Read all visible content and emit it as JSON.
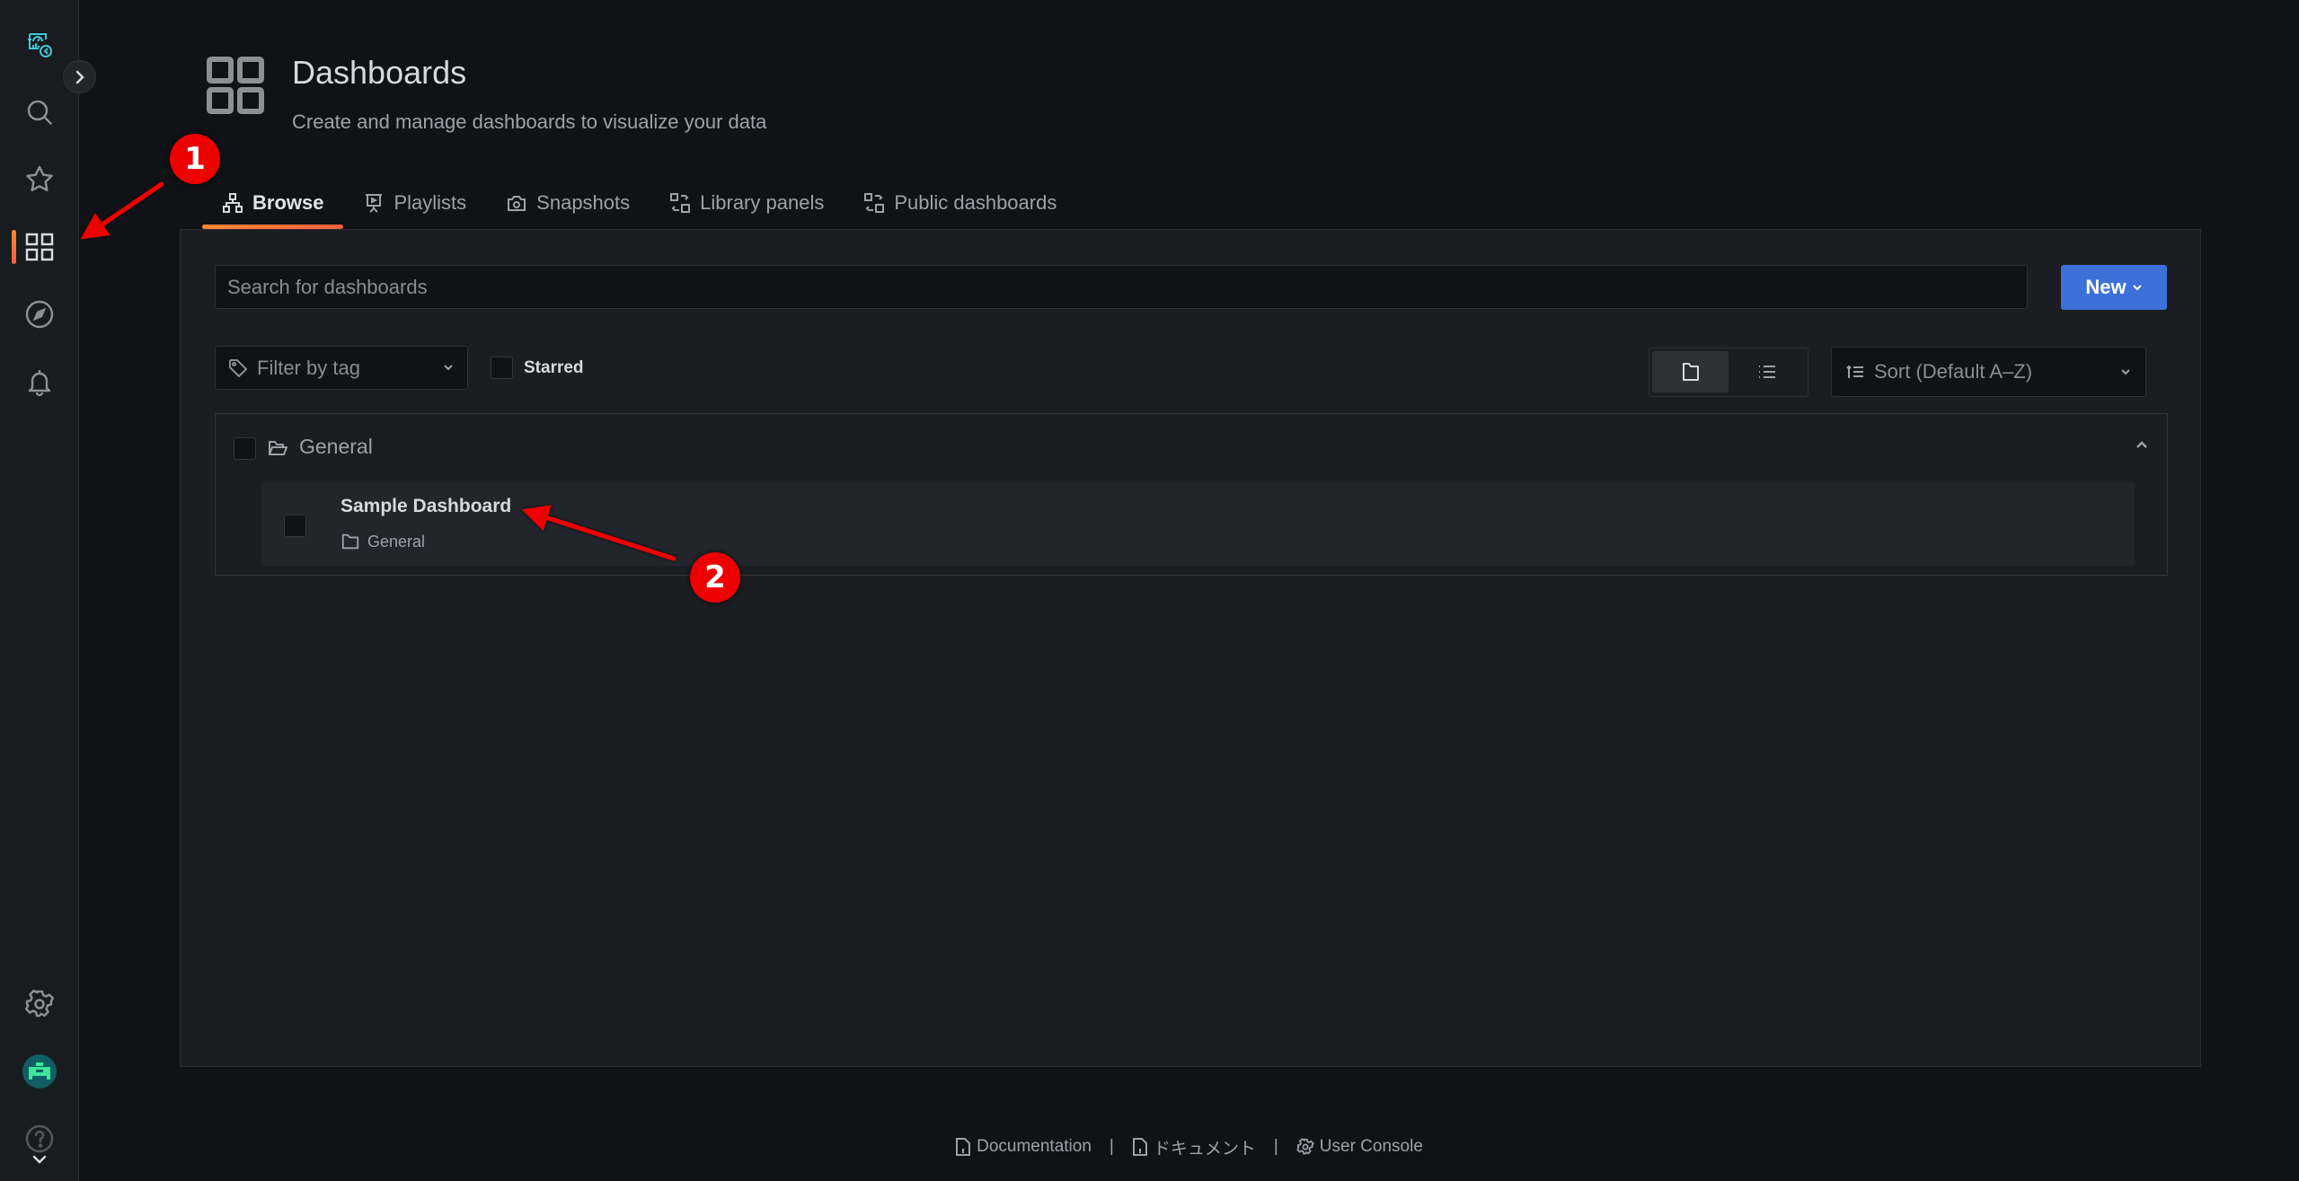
{
  "sidebar": {
    "items": [
      {
        "name": "home",
        "icon": "grafana-logo-icon",
        "active": false
      },
      {
        "name": "search",
        "icon": "search-icon",
        "active": false
      },
      {
        "name": "starred",
        "icon": "star-icon",
        "active": false
      },
      {
        "name": "dashboards",
        "icon": "dashboards-grid-icon",
        "active": true
      },
      {
        "name": "explore",
        "icon": "compass-icon",
        "active": false
      },
      {
        "name": "alerting",
        "icon": "bell-icon",
        "active": false
      }
    ],
    "bottom_items": [
      {
        "name": "administration",
        "icon": "gear-icon"
      },
      {
        "name": "profile",
        "icon": "avatar"
      },
      {
        "name": "help",
        "icon": "help-icon"
      }
    ],
    "accent_color": "#ff8833"
  },
  "header": {
    "title": "Dashboards",
    "subtitle": "Create and manage dashboards to visualize your data"
  },
  "tabs": [
    {
      "label": "Browse",
      "icon": "hierarchy-icon",
      "active": true
    },
    {
      "label": "Playlists",
      "icon": "presentation-play-icon",
      "active": false
    },
    {
      "label": "Snapshots",
      "icon": "camera-icon",
      "active": false
    },
    {
      "label": "Library panels",
      "icon": "library-panel-icon",
      "active": false
    },
    {
      "label": "Public dashboards",
      "icon": "library-panel-icon",
      "active": false
    }
  ],
  "toolbar": {
    "search_placeholder": "Search for dashboards",
    "search_value": "",
    "new_label": "New",
    "filter_placeholder": "Filter by tag",
    "starred_label": "Starred",
    "starred_checked": false,
    "view_mode": "folders",
    "sort_label": "Sort (Default A–Z)"
  },
  "folders": [
    {
      "title": "General",
      "expanded": true,
      "dashboards": [
        {
          "title": "Sample Dashboard",
          "folder": "General"
        }
      ]
    }
  ],
  "footer": {
    "links": [
      {
        "label": "Documentation",
        "icon": "document-info-icon"
      },
      {
        "label": "ドキュメント",
        "icon": "document-info-icon"
      },
      {
        "label": "User Console",
        "icon": "gear-icon"
      }
    ],
    "separator": "|"
  },
  "annotations": [
    {
      "number": "1",
      "target": "sidebar dashboards icon"
    },
    {
      "number": "2",
      "target": "Sample Dashboard"
    }
  ],
  "colors": {
    "primary_button": "#3d71d9",
    "active_tab_gradient_start": "#ff8833",
    "active_tab_gradient_end": "#f55f3e",
    "annotation": "#ee0000",
    "logo": "#3dc9d9"
  }
}
